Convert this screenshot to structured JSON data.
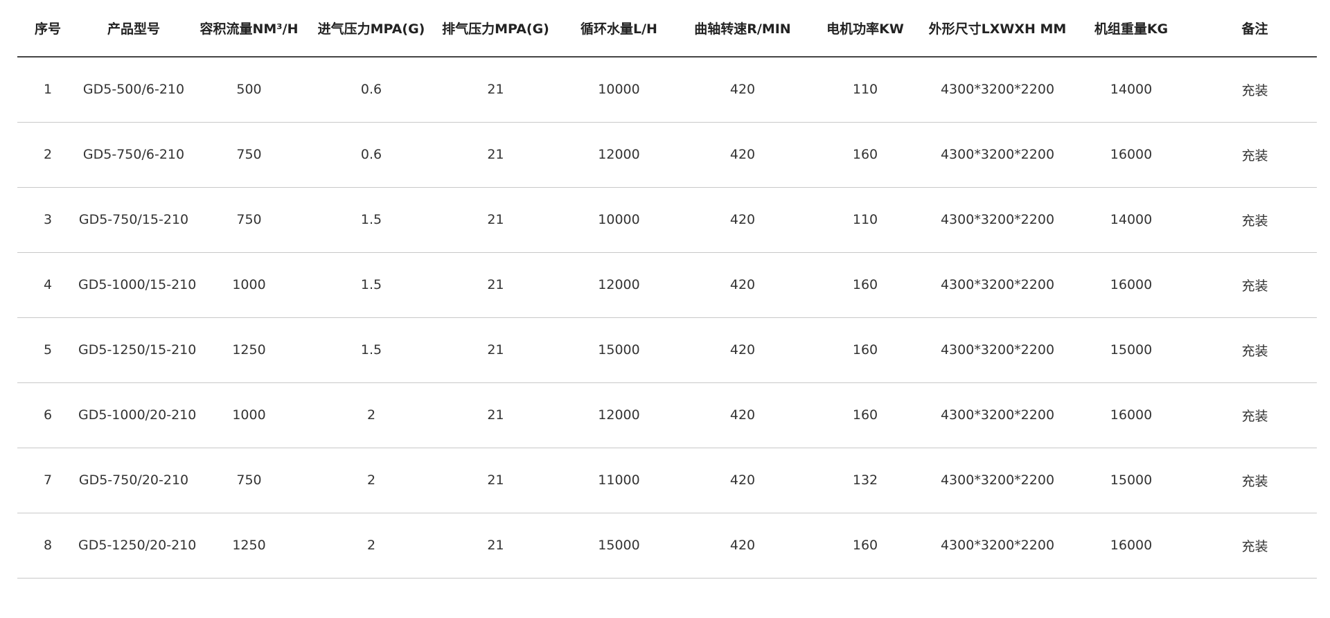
{
  "headers": [
    "序号",
    "产品型号",
    "容积流量NM³/H",
    "进气压力MPA(G)",
    "排气压力MPA(G)",
    "循环水量L/H",
    "曲轴转速R/MIN",
    "电机功率KW",
    "外形尺寸LXWXH MM",
    "机组重量KG",
    "备注"
  ],
  "rows": [
    [
      "1",
      "GD5-500/6-210",
      "500",
      "0.6",
      "21",
      "10000",
      "420",
      "110",
      "4300*3200*2200",
      "14000",
      "充装"
    ],
    [
      "2",
      "GD5-750/6-210",
      "750",
      "0.6",
      "21",
      "12000",
      "420",
      "160",
      "4300*3200*2200",
      "16000",
      "充装"
    ],
    [
      "3",
      "GD5-750/15-210",
      "750",
      "1.5",
      "21",
      "10000",
      "420",
      "110",
      "4300*3200*2200",
      "14000",
      "充装"
    ],
    [
      "4",
      "GD5-1000/15-210",
      "1000",
      "1.5",
      "21",
      "12000",
      "420",
      "160",
      "4300*3200*2200",
      "16000",
      "充装"
    ],
    [
      "5",
      "GD5-1250/15-210",
      "1250",
      "1.5",
      "21",
      "15000",
      "420",
      "160",
      "4300*3200*2200",
      "15000",
      "充装"
    ],
    [
      "6",
      "GD5-1000/20-210",
      "1000",
      "2",
      "21",
      "12000",
      "420",
      "160",
      "4300*3200*2200",
      "16000",
      "充装"
    ],
    [
      "7",
      "GD5-750/20-210",
      "750",
      "2",
      "21",
      "11000",
      "420",
      "132",
      "4300*3200*2200",
      "15000",
      "充装"
    ],
    [
      "8",
      "GD5-1250/20-210",
      "1250",
      "2",
      "21",
      "15000",
      "420",
      "160",
      "4300*3200*2200",
      "16000",
      "充装"
    ]
  ]
}
